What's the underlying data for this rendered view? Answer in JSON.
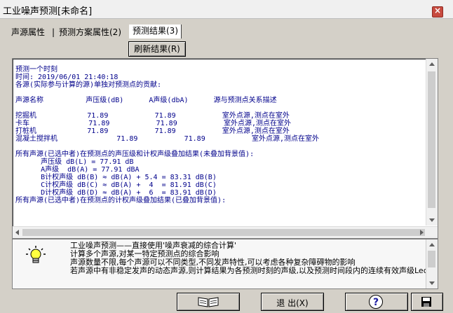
{
  "window": {
    "title": "工业噪声预测[未命名]"
  },
  "tabs": [
    {
      "label": "声源属性"
    },
    {
      "label": "预测方案属性(2)"
    },
    {
      "label": "预测结果(3)"
    }
  ],
  "toolbar": {
    "refresh_label": "刷新结果(R)"
  },
  "result": {
    "lines": [
      "预测一个时刻",
      "时间: 2019/06/01 21:40:18",
      "各源(实际参与计算的源)单独对预测点的贡献:",
      "",
      "声源名称          声压级(dB)      A声级(dbA)      源与预测点关系描述",
      "",
      "挖掘机            71.89           71.89           室外点源,测点在室外",
      "卡车              71.89           71.89           室外点源,测点在室外",
      "打桩机            71.89           71.89           室外点源,测点在室外",
      "混凝土搅拌机              71.89           71.89           室外点源,测点在室外",
      "",
      "所有声源(已选中者)在预测点的声压级和计权声级叠加结果(未叠加背景值):",
      "      声压级 dB(L) = 77.91 dB",
      "      A声级  dB(A) = 77.91 dBA",
      "      B计权声级 dB(B) ≈ dB(A) + 5.4 = 83.31 dB(B)",
      "      C计权声级 dB(C) ≈ dB(A) +  4  = 81.91 dB(C)",
      "      D计权声级 dB(D) ≈ dB(A) +  6  = 83.91 dB(D)",
      "所有声源(已选中者)在预测点的计权声级叠加结果(已叠加背景值):"
    ]
  },
  "help": {
    "text": "    工业噪声预测——直接使用'噪声衰减的综合计算'\n    计算多个声源,对某一特定预测点的综合影响\n    声源数量不限,每个声源可以不同类型,不同发声特性,可以考虑各种复杂障碍物的影响\n    若声源中有非稳定发声的动态声源,则计算结果为各预测时刻的声级,以及预测时间段内的连续有效声级Leq."
  },
  "buttons": {
    "exit_label": "退 出(X)"
  },
  "icons": {
    "bulb": "lightbulb-icon",
    "book": "book-icon",
    "help": "help-icon",
    "save": "save-icon"
  }
}
